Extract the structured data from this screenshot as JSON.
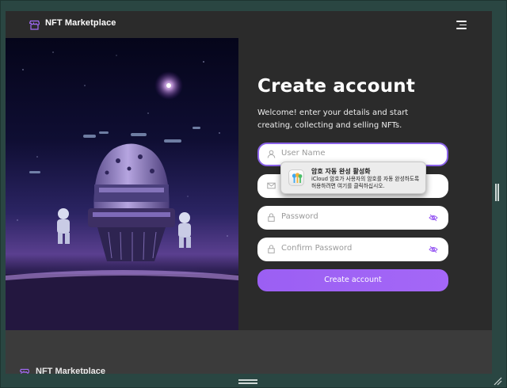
{
  "header": {
    "brand": "NFT Marketplace",
    "logo_icon": "storefront-icon",
    "menu_icon": "hamburger-menu-icon"
  },
  "hero": {
    "image": "astronaut-spaceship-illustration"
  },
  "form": {
    "title": "Create account",
    "subtitle": "Welcome! enter your details and start creating, collecting and selling NFTs.",
    "fields": {
      "username": {
        "placeholder": "User Name",
        "icon": "user-icon"
      },
      "email": {
        "placeholder": "",
        "icon": "mail-icon"
      },
      "password": {
        "placeholder": "Password",
        "icon": "lock-icon",
        "toggle_icon": "eye-off-icon"
      },
      "confirm_password": {
        "placeholder": "Confirm Password",
        "icon": "lock-icon",
        "toggle_icon": "eye-off-icon"
      }
    },
    "submit_label": "Create account"
  },
  "autofill_popup": {
    "title": "암호 자동 완성 활성화",
    "line1": "iCloud 암호가 사용자의 암호를 자동 완성하도록",
    "line2": "허용하려면 여기를 클릭하십시오.",
    "icon": "passwords-app-icon"
  },
  "footer": {
    "brand": "NFT Marketplace"
  },
  "colors": {
    "accent": "#9b5ff3",
    "background": "#2b2b2b",
    "window_backdrop": "#2a4642"
  }
}
